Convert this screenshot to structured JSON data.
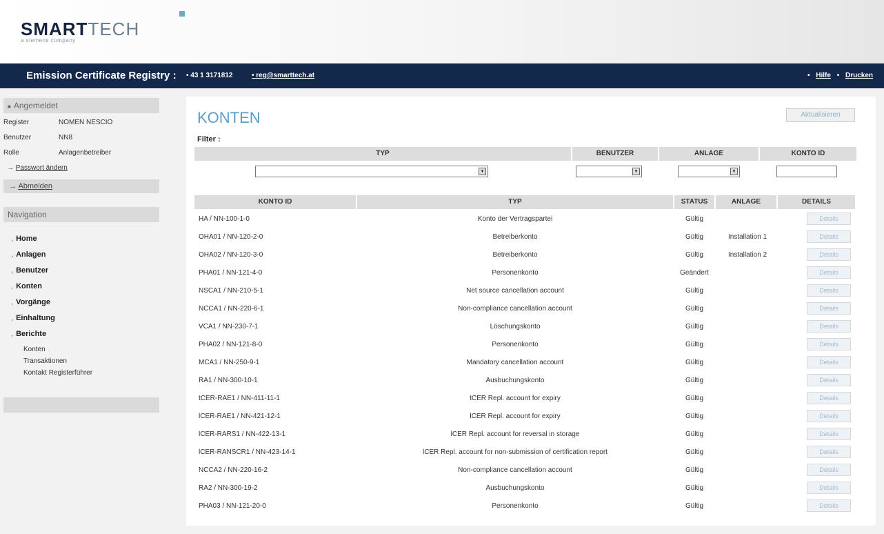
{
  "header": {
    "logo_bold": "SMART",
    "logo_light": "TECH",
    "logo_sub": "a siemens company",
    "title": "Emission Certificate Registry :",
    "phone": "• 43 1 3171812",
    "email": "• reg@smarttech.at",
    "help_bullet": "•",
    "help": "Hilfe",
    "print_bullet": "•",
    "print": "Drucken"
  },
  "sidebar": {
    "logged_in": "Angemeldet",
    "info": [
      {
        "key": "Register",
        "value": "NOMEN NESCIO"
      },
      {
        "key": "Benutzer",
        "value": "NN8"
      },
      {
        "key": "Rolle",
        "value": "Anlagenbetreiber"
      }
    ],
    "change_password": "Passwort ändern",
    "logout": "Abmelden",
    "navigation_title": "Navigation",
    "nav": [
      "Home",
      "Anlagen",
      "Benutzer",
      "Konten",
      "Vorgänge",
      "Einhaltung",
      "Berichte"
    ],
    "reports": [
      "Konten",
      "Transaktionen",
      "Kontakt Registerführer"
    ]
  },
  "main": {
    "title": "KONTEN",
    "refresh": "Aktualisieren",
    "filter_label": "Filter :",
    "filter_headers": {
      "typ": "TYP",
      "benutzer": "BENUTZER",
      "anlage": "ANLAGE",
      "konto_id": "KONTO ID"
    },
    "table_headers": {
      "konto_id": "KONTO ID",
      "typ": "TYP",
      "status": "STATUS",
      "anlage": "ANLAGE",
      "details": "DETAILS"
    },
    "details_label": "Details",
    "rows": [
      {
        "id": "HA / NN-100-1-0",
        "typ": "Konto der Vertragspartei",
        "status": "Gültig",
        "anlage": ""
      },
      {
        "id": "OHA01 / NN-120-2-0",
        "typ": "Betreiberkonto",
        "status": "Gültig",
        "anlage": "Installation 1"
      },
      {
        "id": "OHA02 / NN-120-3-0",
        "typ": "Betreiberkonto",
        "status": "Gültig",
        "anlage": "Installation 2"
      },
      {
        "id": "PHA01 / NN-121-4-0",
        "typ": "Personenkonto",
        "status": "Geändert",
        "anlage": ""
      },
      {
        "id": "NSCA1 / NN-210-5-1",
        "typ": "Net source cancellation account",
        "status": "Gültig",
        "anlage": ""
      },
      {
        "id": "NCCA1 / NN-220-6-1",
        "typ": "Non-compliance cancellation account",
        "status": "Gültig",
        "anlage": ""
      },
      {
        "id": "VCA1 / NN-230-7-1",
        "typ": "Löschungskonto",
        "status": "Gültig",
        "anlage": ""
      },
      {
        "id": "PHA02 / NN-121-8-0",
        "typ": "Personenkonto",
        "status": "Gültig",
        "anlage": ""
      },
      {
        "id": "MCA1 / NN-250-9-1",
        "typ": "Mandatory cancellation account",
        "status": "Gültig",
        "anlage": ""
      },
      {
        "id": "RA1 / NN-300-10-1",
        "typ": "Ausbuchungskonto",
        "status": "Gültig",
        "anlage": ""
      },
      {
        "id": "tCER-RAE1 / NN-411-11-1",
        "typ": "tCER Repl. account for expiry",
        "status": "Gültig",
        "anlage": ""
      },
      {
        "id": "lCER-RAE1 / NN-421-12-1",
        "typ": "lCER Repl. account for expiry",
        "status": "Gültig",
        "anlage": ""
      },
      {
        "id": "lCER-RARS1 / NN-422-13-1",
        "typ": "lCER Repl. account for reversal in storage",
        "status": "Gültig",
        "anlage": ""
      },
      {
        "id": "lCER-RANSCR1 / NN-423-14-1",
        "typ": "lCER Repl. account for non-submission of certification report",
        "status": "Gültig",
        "anlage": ""
      },
      {
        "id": "NCCA2 / NN-220-16-2",
        "typ": "Non-compliance cancellation account",
        "status": "Gültig",
        "anlage": ""
      },
      {
        "id": "RA2 / NN-300-19-2",
        "typ": "Ausbuchungskonto",
        "status": "Gültig",
        "anlage": ""
      },
      {
        "id": "PHA03 / NN-121-20-0",
        "typ": "Personenkonto",
        "status": "Gültig",
        "anlage": ""
      }
    ]
  }
}
